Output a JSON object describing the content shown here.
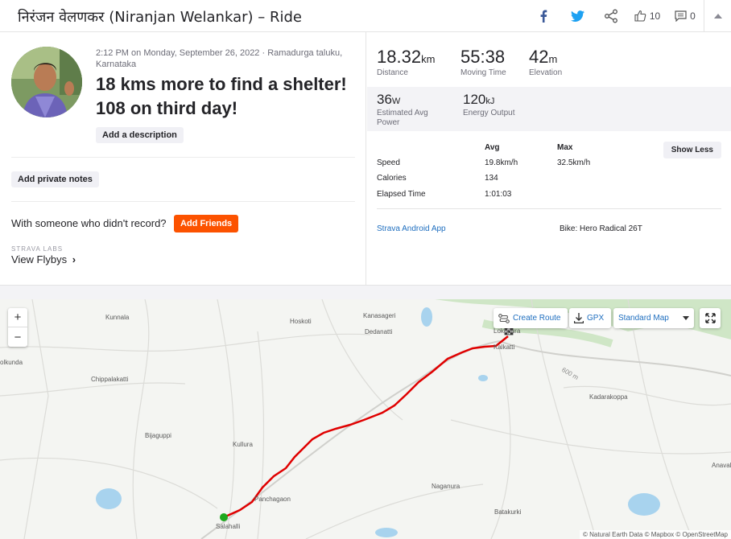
{
  "header": {
    "title": "निरंजन वेलणकर (Niranjan Welankar) – Ride",
    "kudos_count": "10",
    "comment_count": "0"
  },
  "activity": {
    "meta": "2:12 PM on Monday, September 26, 2022 · Ramadurga taluku, Karnataka",
    "title": "18 kms more to find a shelter! 108 on third day!",
    "add_description": "Add a description",
    "add_private_notes": "Add private notes",
    "with_someone": "With someone who didn't record?",
    "add_friends": "Add Friends",
    "labs_label": "STRAVA LABS",
    "view_flybys": "View Flybys"
  },
  "stats": {
    "distance": {
      "value": "18.32",
      "unit": "km",
      "label": "Distance"
    },
    "moving_time": {
      "value": "55:38",
      "label": "Moving Time"
    },
    "elevation": {
      "value": "42",
      "unit": "m",
      "label": "Elevation"
    },
    "power": {
      "value": "36",
      "unit": "W",
      "label": "Estimated Avg Power"
    },
    "energy": {
      "value": "120",
      "unit": "kJ",
      "label": "Energy Output"
    }
  },
  "details": {
    "col_avg": "Avg",
    "col_max": "Max",
    "show_less": "Show Less",
    "rows": [
      {
        "label": "Speed",
        "avg": "19.8km/h",
        "max": "32.5km/h"
      },
      {
        "label": "Calories",
        "avg": "134",
        "max": ""
      },
      {
        "label": "Elapsed Time",
        "avg": "1:01:03",
        "max": ""
      }
    ],
    "device": "Strava Android App",
    "bike": "Bike: Hero Radical 26T"
  },
  "map": {
    "zoom_in": "+",
    "zoom_out": "−",
    "create_route": "Create Route",
    "gpx": "GPX",
    "map_type": "Standard Map",
    "attribution": "© Natural Earth Data © Mapbox © OpenStreetMap",
    "places": [
      "Kunnala",
      "Hoskoti",
      "Kanasageri",
      "Dedanatti",
      "Kalkatti",
      "olkunda",
      "Chippalakatti",
      "Bijaguppi",
      "Kullura",
      "Kadarakoppa",
      "Panchagaon",
      "Naganura",
      "Batakurki",
      "Salahalli",
      "Anaval",
      "Lokapura",
      "600 m"
    ],
    "route_color": "#e00000"
  }
}
